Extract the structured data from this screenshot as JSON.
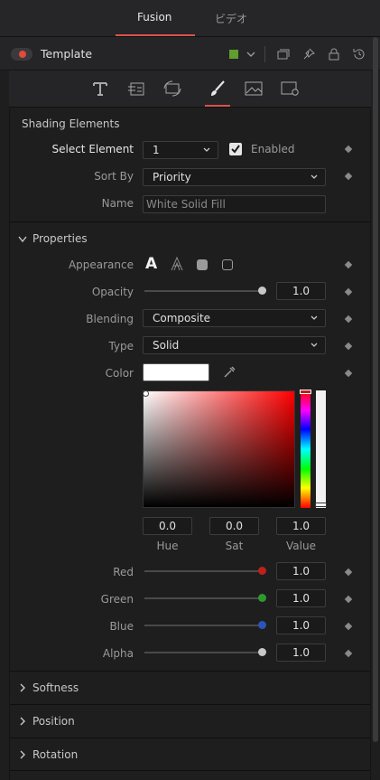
{
  "top_tabs": [
    "Fusion",
    "ビデオ"
  ],
  "node": {
    "name": "Template",
    "color": "#5f9e2f"
  },
  "shading": {
    "title": "Shading Elements",
    "select_element_label": "Select Element",
    "select_element_value": "1",
    "enabled_label": "Enabled",
    "enabled": true,
    "sort_by_label": "Sort By",
    "sort_by_value": "Priority",
    "name_label": "Name",
    "name_placeholder": "White Solid Fill"
  },
  "properties": {
    "title": "Properties",
    "appearance_label": "Appearance",
    "appearance_glyph": "A",
    "opacity_label": "Opacity",
    "opacity_value": "1.0",
    "opacity_fraction": 1.0,
    "blending_label": "Blending",
    "blending_value": "Composite",
    "type_label": "Type",
    "type_value": "Solid",
    "color_label": "Color",
    "color_hex": "#ffffff",
    "hue_label": "Hue",
    "hue_value": "0.0",
    "sat_label": "Sat",
    "sat_value": "0.0",
    "val_label": "Value",
    "val_value": "1.0",
    "red_label": "Red",
    "red_value": "1.0",
    "red_color": "#c0201a",
    "green_label": "Green",
    "green_value": "1.0",
    "green_color": "#2e9a2e",
    "blue_label": "Blue",
    "blue_value": "1.0",
    "blue_color": "#2a55b8",
    "alpha_label": "Alpha",
    "alpha_value": "1.0",
    "alpha_color": "#c8c8c8"
  },
  "sections": [
    "Softness",
    "Position",
    "Rotation"
  ],
  "accent_color": "#d9534f"
}
